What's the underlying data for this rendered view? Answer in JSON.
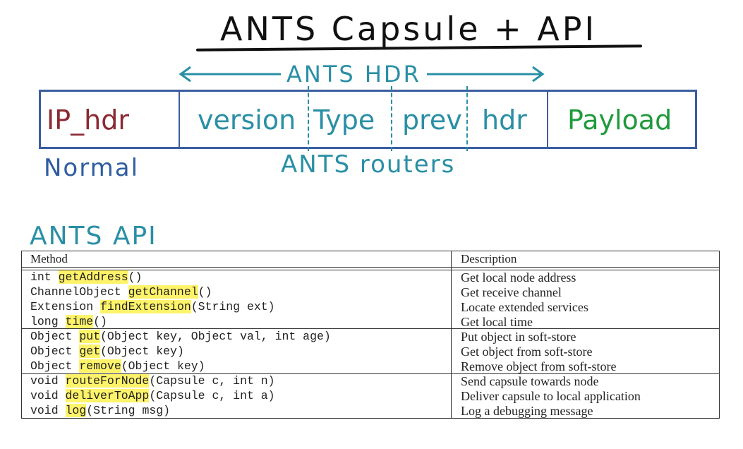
{
  "title": "ANTS Capsule + API",
  "diagram": {
    "hdr_label": "ANTS HDR",
    "cells": {
      "ip_hdr": "IP_hdr",
      "version": "version",
      "type": "Type",
      "prev": "prev",
      "hdr": "hdr",
      "payload": "Payload"
    },
    "normal_label": "Normal",
    "routers_label": "ANTS routers"
  },
  "api_label": "ANTS API",
  "table": {
    "headers": {
      "method": "Method",
      "description": "Description"
    },
    "rows": [
      {
        "pre": "int ",
        "name": "getAddress",
        "post": "()",
        "desc": "Get local node address"
      },
      {
        "pre": "ChannelObject ",
        "name": "getChannel",
        "post": "()",
        "desc": "Get receive channel"
      },
      {
        "pre": "Extension ",
        "name": "findExtension",
        "post": "(String ext)",
        "desc": "Locate extended services"
      },
      {
        "pre": "long ",
        "name": "time",
        "post": "()",
        "desc": "Get local time"
      },
      {
        "pre": "Object ",
        "name": "put",
        "post": "(Object key, Object val, int age)",
        "desc": "Put object in soft-store"
      },
      {
        "pre": "Object ",
        "name": "get",
        "post": "(Object key)",
        "desc": "Get object from soft-store"
      },
      {
        "pre": "Object ",
        "name": "remove",
        "post": "(Object key)",
        "desc": "Remove object from soft-store"
      },
      {
        "pre": "void ",
        "name": "routeForNode",
        "post": "(Capsule c, int n)",
        "desc": "Send capsule towards node"
      },
      {
        "pre": "void ",
        "name": "deliverToApp",
        "post": "(Capsule c, int a)",
        "desc": "Deliver capsule to local application"
      },
      {
        "pre": "void ",
        "name": "log",
        "post": "(String msg)",
        "desc": "Log a debugging message"
      }
    ]
  },
  "colors": {
    "ink": "#111111",
    "teal": "#2a8fa5",
    "box_blue": "#3b5da0",
    "ip_red": "#8b2a33",
    "payload_green": "#1f9a3c",
    "highlight": "#fff36a"
  }
}
